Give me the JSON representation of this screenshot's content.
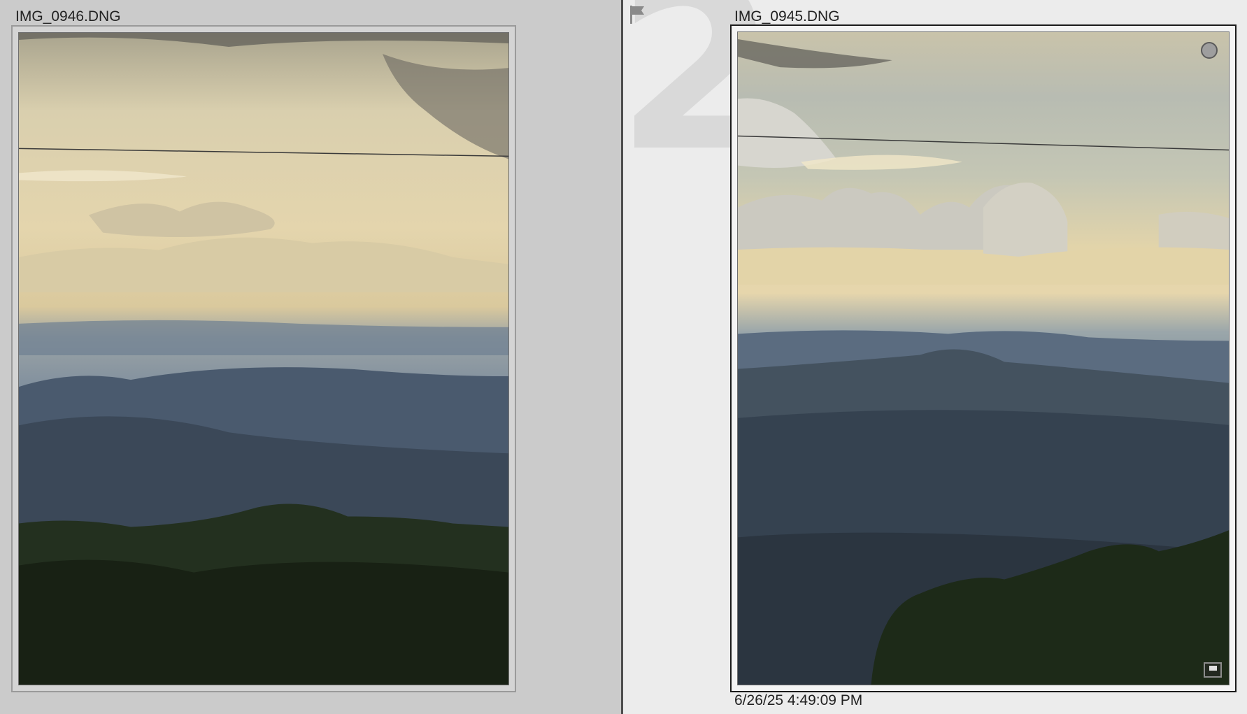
{
  "left_photo": {
    "filename": "IMG_0946.DNG"
  },
  "right_photo": {
    "filename": "IMG_0945.DNG",
    "candidate_number": "2",
    "timestamp": "6/26/25 4:49:09 PM",
    "icons": [
      "flag-icon",
      "rating-circle-icon",
      "comment-icon"
    ]
  },
  "colors": {
    "left_background": "#cbcbcb",
    "right_background": "#ececec",
    "selected_frame": "#1b1b1b"
  }
}
